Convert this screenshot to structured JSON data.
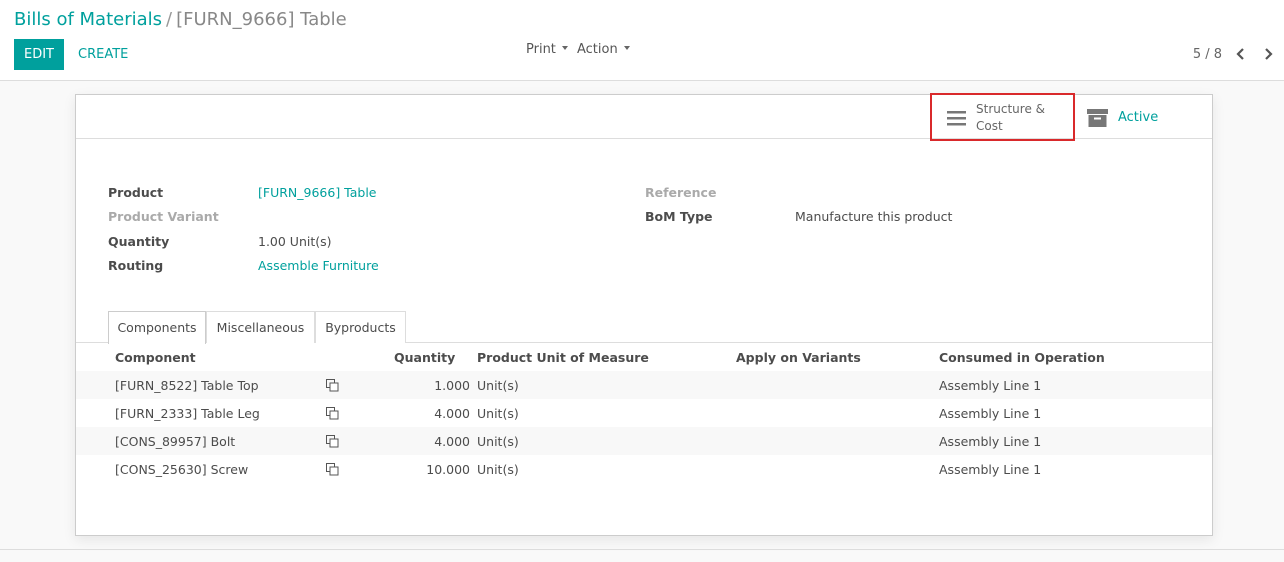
{
  "breadcrumb": {
    "parent": "Bills of Materials",
    "separator": "/",
    "current": "[FURN_9666] Table"
  },
  "toolbar": {
    "edit_label": "EDIT",
    "create_label": "CREATE",
    "print_label": "Print",
    "action_label": "Action"
  },
  "pager": {
    "value": "5 / 8"
  },
  "button_box": {
    "structure_label": "Structure & Cost",
    "active_label": "Active"
  },
  "fields": {
    "product_label": "Product",
    "product_value": "[FURN_9666] Table",
    "variant_label": "Product Variant",
    "quantity_label": "Quantity",
    "quantity_value": "1.00 Unit(s)",
    "routing_label": "Routing",
    "routing_value": "Assemble Furniture",
    "reference_label": "Reference",
    "bom_type_label": "BoM Type",
    "bom_type_value": "Manufacture this product"
  },
  "tabs": [
    {
      "label": "Components"
    },
    {
      "label": "Miscellaneous"
    },
    {
      "label": "Byproducts"
    }
  ],
  "table": {
    "headers": {
      "component": "Component",
      "quantity": "Quantity",
      "uom": "Product Unit of Measure",
      "variants": "Apply on Variants",
      "operation": "Consumed in Operation"
    },
    "rows": [
      {
        "component": "[FURN_8522] Table Top",
        "quantity": "1.000",
        "uom": "Unit(s)",
        "variants": "",
        "operation": "Assembly Line 1"
      },
      {
        "component": "[FURN_2333] Table Leg",
        "quantity": "4.000",
        "uom": "Unit(s)",
        "variants": "",
        "operation": "Assembly Line 1"
      },
      {
        "component": "[CONS_89957] Bolt",
        "quantity": "4.000",
        "uom": "Unit(s)",
        "variants": "",
        "operation": "Assembly Line 1"
      },
      {
        "component": "[CONS_25630] Screw",
        "quantity": "10.000",
        "uom": "Unit(s)",
        "variants": "",
        "operation": "Assembly Line 1"
      }
    ]
  },
  "colors": {
    "accent": "#00a09d",
    "highlight_border": "#d9292b"
  }
}
